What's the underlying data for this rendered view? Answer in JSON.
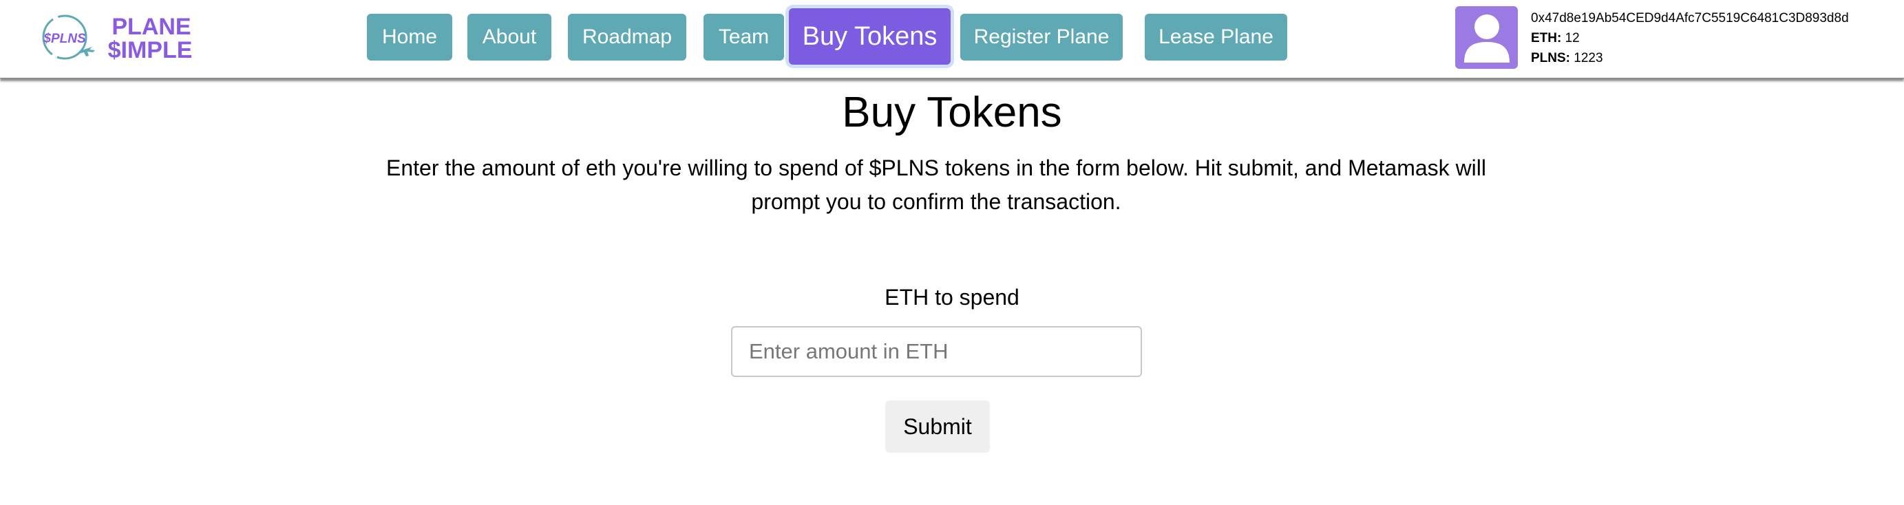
{
  "brand": {
    "logo_text_top": "PLANE",
    "logo_text_bottom": "$IMPLE",
    "coin_text": "$PLNS"
  },
  "nav": [
    {
      "label": "Home"
    },
    {
      "label": "About"
    },
    {
      "label": "Roadmap"
    },
    {
      "label": "Team"
    },
    {
      "label": "Buy Tokens",
      "active": true
    },
    {
      "label": "Register Plane"
    },
    {
      "label": "Lease Plane"
    }
  ],
  "wallet": {
    "address": "0x47d8e19Ab54CED9d4Afc7C5519C6481C3D893d8d",
    "eth_label": "ETH:",
    "eth_value": "12",
    "plns_label": "PLNS:",
    "plns_value": "1223",
    "avatar_icon": "user-icon"
  },
  "main": {
    "title": "Buy Tokens",
    "description": "Enter the amount of eth you're willing to spend of $PLNS tokens in the form below. Hit submit, and Metamask will prompt you to confirm the transaction.",
    "field_label": "ETH to spend",
    "input_placeholder": "Enter amount in ETH",
    "input_value": "",
    "submit_label": "Submit"
  },
  "colors": {
    "nav": "#5fa9b5",
    "active": "#7c5ce0",
    "avatar": "#9b7ae4",
    "logo": "#8a5ae0"
  }
}
